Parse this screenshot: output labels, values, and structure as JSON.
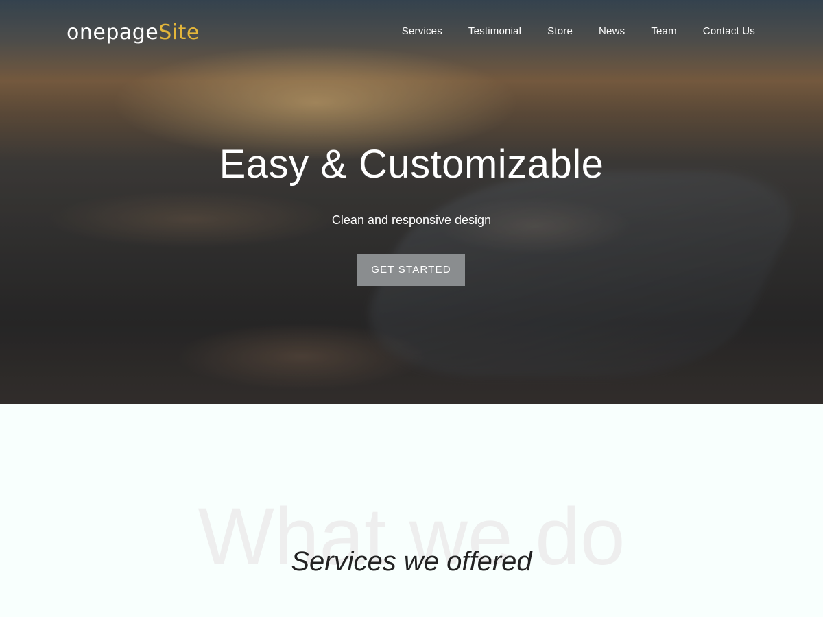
{
  "brand": {
    "logo_main": "onepage",
    "logo_accent": "Site",
    "accent_color": "#e4b63a"
  },
  "nav": {
    "items": [
      {
        "label": "Services"
      },
      {
        "label": "Testimonial"
      },
      {
        "label": "Store"
      },
      {
        "label": "News"
      },
      {
        "label": "Team"
      },
      {
        "label": "Contact Us"
      }
    ]
  },
  "hero": {
    "title": "Easy & Customizable",
    "subtitle": "Clean and responsive design",
    "cta_label": "GET STARTED",
    "cta_color": "#8a8d8f"
  },
  "services": {
    "watermark": "What we do",
    "title": "Services we offered",
    "background_color": "#f8fffd"
  }
}
